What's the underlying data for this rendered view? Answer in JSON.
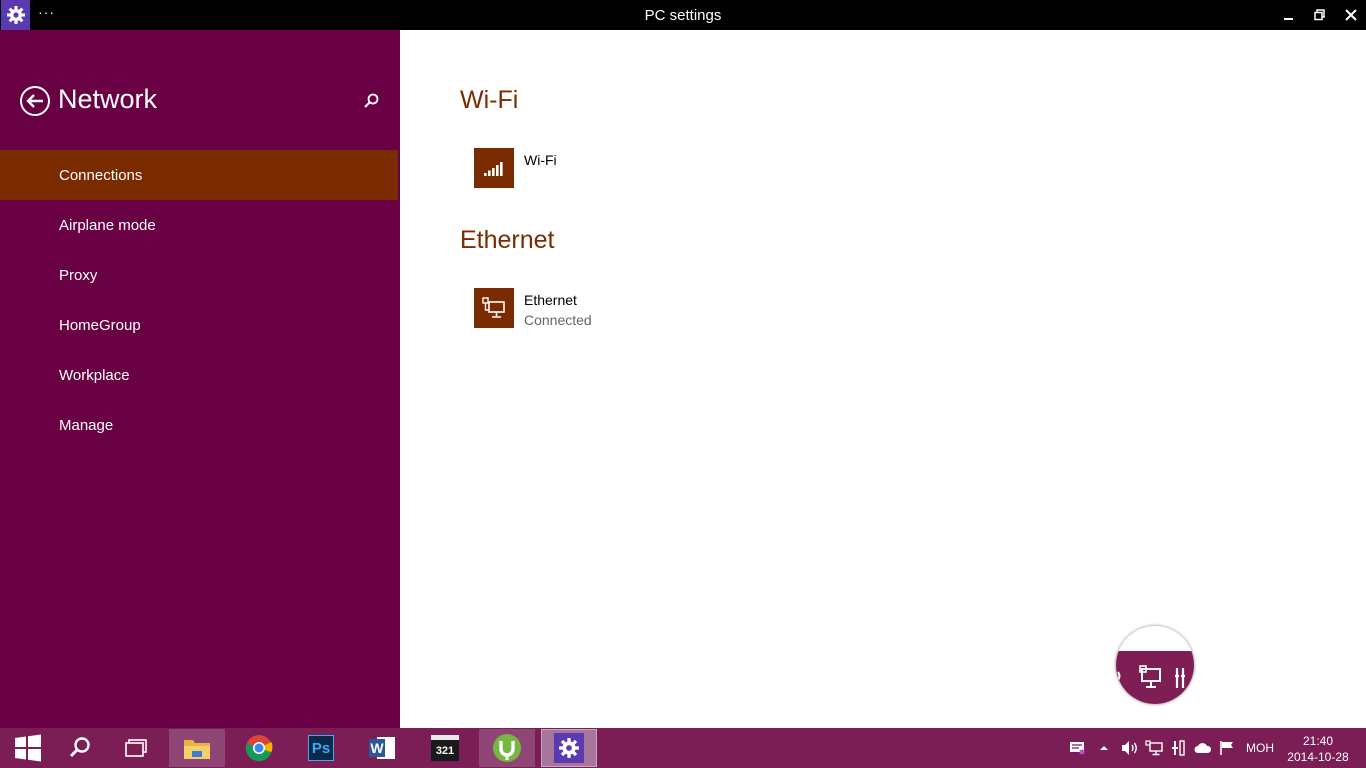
{
  "window": {
    "title": "PC settings",
    "menu_glyph": "···",
    "app_icon": "gear-icon"
  },
  "sidebar": {
    "title": "Network",
    "back_icon": "back-arrow-icon",
    "search_icon": "search-icon",
    "items": [
      {
        "label": "Connections",
        "active": true
      },
      {
        "label": "Airplane mode",
        "active": false
      },
      {
        "label": "Proxy",
        "active": false
      },
      {
        "label": "HomeGroup",
        "active": false
      },
      {
        "label": "Workplace",
        "active": false
      },
      {
        "label": "Manage",
        "active": false
      }
    ]
  },
  "main": {
    "sections": [
      {
        "title": "Wi-Fi",
        "network": {
          "name": "Wi-Fi",
          "status": "",
          "icon": "wifi-signal-icon"
        }
      },
      {
        "title": "Ethernet",
        "network": {
          "name": "Ethernet",
          "status": "Connected",
          "icon": "ethernet-icon"
        }
      }
    ]
  },
  "taskbar": {
    "apps": [
      {
        "name": "file-explorer",
        "state": "pinned"
      },
      {
        "name": "chrome",
        "state": "normal"
      },
      {
        "name": "photoshop",
        "label": "Ps",
        "state": "normal"
      },
      {
        "name": "word",
        "label": "W",
        "state": "normal"
      },
      {
        "name": "media-player-classic",
        "label": "321",
        "state": "normal"
      },
      {
        "name": "utorrent",
        "state": "pinned"
      },
      {
        "name": "pc-settings",
        "state": "active"
      }
    ],
    "tray": {
      "language": "МОН",
      "time": "21:40",
      "date": "2014-10-28"
    }
  },
  "colors": {
    "sidebar": "#690043",
    "accent": "#7a2b00",
    "taskbar": "#7b1e56",
    "titlebar": "#000000"
  }
}
